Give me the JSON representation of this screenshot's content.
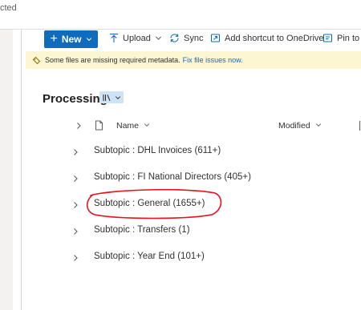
{
  "window": {
    "status_text": "cted"
  },
  "command_bar": {
    "new_label": "New",
    "upload_label": "Upload",
    "sync_label": "Sync",
    "shortcut_label": "Add shortcut to OneDrive",
    "pin_label": "Pin to C"
  },
  "warning_bar": {
    "message": "Some files are missing required metadata.",
    "link": "Fix file issues now."
  },
  "page": {
    "title": "Processing"
  },
  "columns": {
    "name": "Name",
    "modified": "Modified"
  },
  "groups": [
    {
      "label": "Subtopic : DHL Invoices (611+)"
    },
    {
      "label": "Subtopic : FI National Directors (405+)"
    },
    {
      "label": "Subtopic : General (1655+)"
    },
    {
      "label": "Subtopic : Transfers (1)"
    },
    {
      "label": "Subtopic : Year End (101+)"
    }
  ],
  "colors": {
    "accent": "#0f6cbd",
    "warning_bg": "#fdf6d3",
    "annotation": "#e8101a"
  },
  "annotation": {
    "shape": "hand-drawn red ellipse",
    "target": "Subtopic : General (1655+)"
  }
}
